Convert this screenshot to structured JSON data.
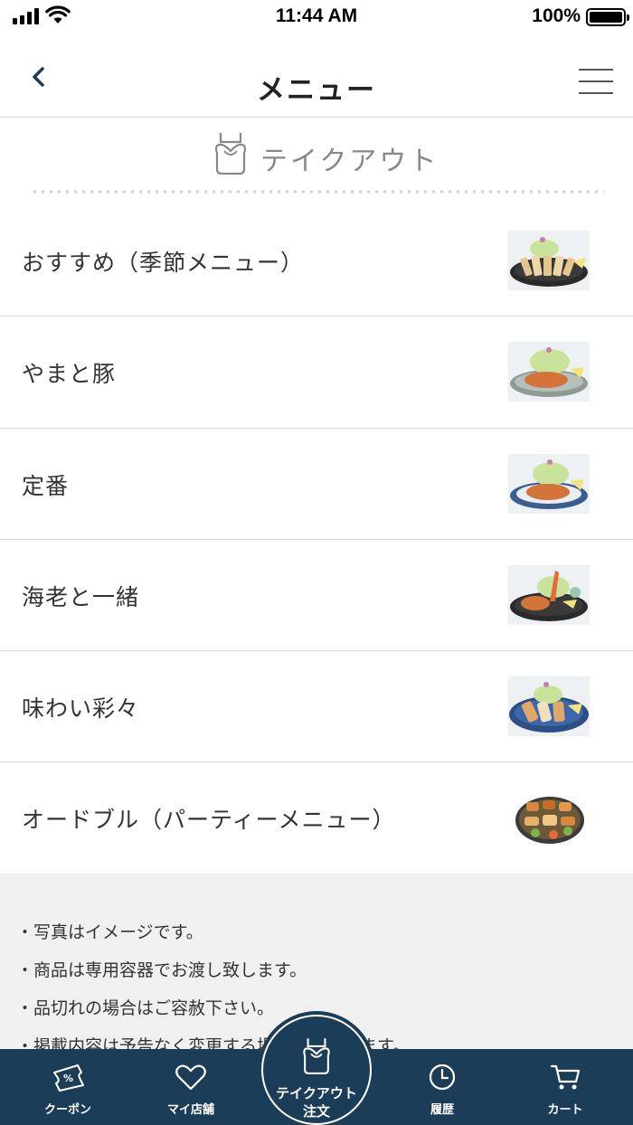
{
  "status_bar": {
    "time": "11:44 AM",
    "battery": "100%"
  },
  "header": {
    "title": "メニュー",
    "back_icon": "chevron-left-icon",
    "menu_icon": "hamburger-icon"
  },
  "takeout": {
    "label": "テイクアウト",
    "icon": "takeout-bag-icon"
  },
  "categories": [
    {
      "label": "おすすめ（季節メニュー）",
      "image": "seasonal-katsu-photo"
    },
    {
      "label": "やまと豚",
      "image": "yamato-pork-katsu-photo"
    },
    {
      "label": "定番",
      "image": "standard-katsu-photo"
    },
    {
      "label": "海老と一緒",
      "image": "shrimp-katsu-photo"
    },
    {
      "label": "味わい彩々",
      "image": "assorted-katsu-photo"
    },
    {
      "label": "オードブル（パーティーメニュー）",
      "image": "party-platter-photo"
    }
  ],
  "notes": [
    "・写真はイメージです。",
    "・商品は専用容器でお渡し致します。",
    "・品切れの場合はご容赦下さい。",
    "・掲載内容は予告なく変更する場合がございます。"
  ],
  "tabbar": {
    "coupon": "クーポン",
    "my_store": "マイ店舗",
    "takeout_line1": "テイクアウト",
    "takeout_line2": "注文",
    "history": "履歴",
    "cart": "カート"
  },
  "colors": {
    "tabbar_bg": "#1c3d57",
    "accent": "#1c3d57"
  }
}
